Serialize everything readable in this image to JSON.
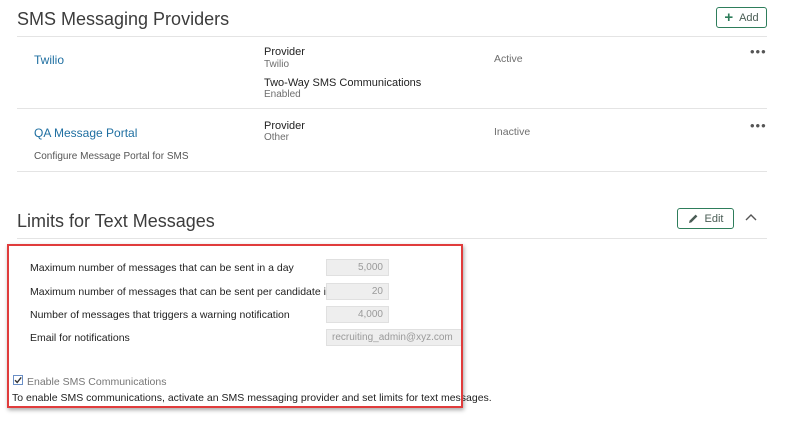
{
  "providers": {
    "title": "SMS Messaging Providers",
    "add_label": "Add",
    "rows": [
      {
        "name": "Twilio",
        "provider_label": "Provider",
        "provider_value": "Twilio",
        "extra_label": "Two-Way SMS Communications",
        "extra_value": "Enabled",
        "status": "Active",
        "more": "•••"
      },
      {
        "name": "QA Message Portal",
        "description": "Configure Message Portal for SMS",
        "provider_label": "Provider",
        "provider_value": "Other",
        "status": "Inactive",
        "more": "•••"
      }
    ]
  },
  "limits": {
    "title": "Limits for Text Messages",
    "edit_label": "Edit",
    "fields": [
      {
        "label": "Maximum number of messages that can be sent in a day",
        "value": "5,000"
      },
      {
        "label": "Maximum number of messages that can be sent per candidate in a day",
        "value": "20"
      },
      {
        "label": "Number of messages that triggers a warning notification",
        "value": "4,000"
      },
      {
        "label": "Email for notifications",
        "value": "recruiting_admin@xyz.com"
      }
    ],
    "enable_label": "Enable SMS Communications",
    "enable_checked": true,
    "help_text": "To enable SMS communications, activate an SMS messaging provider and set limits for text messages."
  },
  "colors": {
    "accent": "#2e7d5b",
    "link": "#1f6fa1",
    "highlight": "#e03c3c"
  }
}
